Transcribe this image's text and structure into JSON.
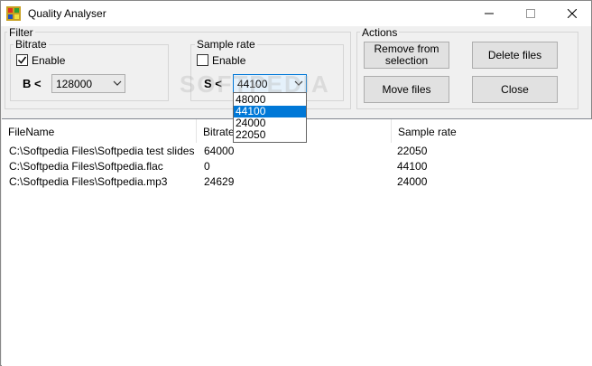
{
  "window": {
    "title": "Quality Analyser"
  },
  "filter": {
    "legend": "Filter",
    "bitrate": {
      "legend": "Bitrate",
      "enable_label": "Enable",
      "enabled": true,
      "operator_label": "B <",
      "value": "128000"
    },
    "sample_rate": {
      "legend": "Sample rate",
      "enable_label": "Enable",
      "enabled": false,
      "operator_label": "S <",
      "value": "44100",
      "options": [
        "48000",
        "44100",
        "24000",
        "22050"
      ],
      "highlighted_option": "44100"
    }
  },
  "actions": {
    "legend": "Actions",
    "remove_label_1": "Remove from",
    "remove_label_2": "selection",
    "delete_label": "Delete files",
    "move_label": "Move files",
    "close_label": "Close"
  },
  "files": {
    "headers": {
      "filename": "FileName",
      "bitrate": "Bitrate",
      "sample_rate": "Sample rate"
    },
    "rows": [
      {
        "filename": "C:\\Softpedia Files\\Softpedia test slidesho...",
        "bitrate": "64000",
        "sample_rate": "22050"
      },
      {
        "filename": "C:\\Softpedia Files\\Softpedia.flac",
        "bitrate": "0",
        "sample_rate": "44100"
      },
      {
        "filename": "C:\\Softpedia Files\\Softpedia.mp3",
        "bitrate": "24629",
        "sample_rate": "24000"
      }
    ]
  },
  "watermark": "SOFTPEDIA",
  "colors": {
    "accent": "#0078d7",
    "window_bg": "#f0f0f0"
  }
}
